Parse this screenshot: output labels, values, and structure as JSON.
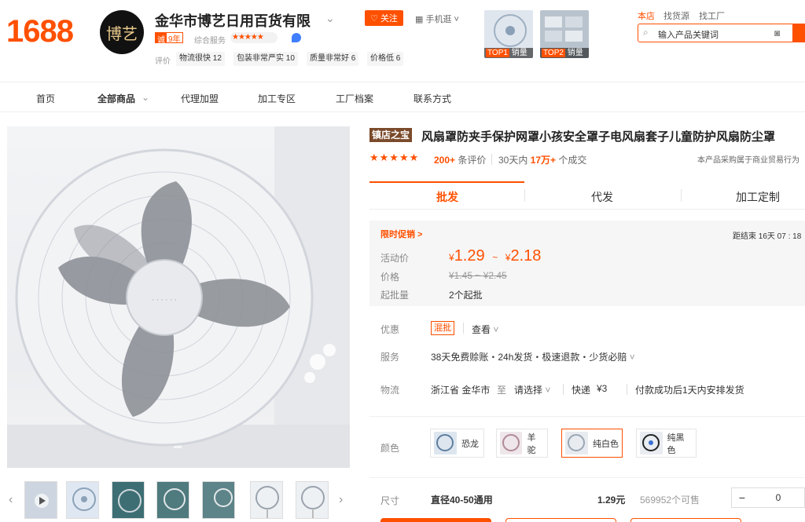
{
  "header": {
    "logo": "1688",
    "shop_avatar_text": "博艺",
    "shop_name": "金华市博艺日用百货有限",
    "follow": "关注",
    "mobile_shop": "手机逛",
    "year_badge_a": "诚",
    "year_badge_b": "9年",
    "service_label": "综合服务",
    "service_stars": "★★★★★",
    "eval_label": "评价",
    "eval_chips": [
      "物流很快 12",
      "包装非常严实 10",
      "质量非常好 6",
      "价格低 6"
    ],
    "top_thumbs": [
      {
        "rank": "TOP1",
        "label": "销量"
      },
      {
        "rank": "TOP2",
        "label": "销量"
      }
    ],
    "top_links": [
      "本店",
      "找货源",
      "找工厂"
    ],
    "search_placeholder": "输入产品关键词"
  },
  "nav": [
    "首页",
    "全部商品",
    "代理加盟",
    "加工专区",
    "工厂档案",
    "联系方式"
  ],
  "product": {
    "badge": "镇店之宝",
    "title": "风扇罩防夹手保护网罩小孩安全罩子电风扇套子儿童防护风扇防尘罩",
    "rating_stars": "★★★★★",
    "review_count": "200+",
    "review_suffix": "条评价",
    "sold_prefix": "30天内",
    "sold_count": "17万+",
    "sold_suffix": "个成交",
    "b2b_note": "本产品采购属于商业贸易行为",
    "tabs": [
      "批发",
      "代发",
      "加工定制"
    ],
    "promo_label": "限时促销 >",
    "countdown": "距结束  16天 07 : 18",
    "price_label": "活动价",
    "price_low": "1.29",
    "price_high": "2.18",
    "currency": "¥",
    "tilde": "~",
    "orig_label": "价格",
    "orig_price": "¥1.45  ~  ¥2.45",
    "moq_label": "起批量",
    "moq": "2个起批",
    "discount_label": "优惠",
    "discount_tag": "混批",
    "discount_view": "查看",
    "service_label": "服务",
    "service_text": "38天免费赊账・24h发货・极速退款・少货必赔",
    "logistics_label": "物流",
    "origin": "浙江省 金华市",
    "to": "至",
    "dest": "请选择",
    "express": "快递",
    "express_fee": "¥3",
    "ship_note": "付款成功后1天内安排发货",
    "color_label": "颜色",
    "colors": [
      "恐龙",
      "羊驼",
      "纯白色",
      "纯黑色"
    ],
    "size_label": "尺寸",
    "size_name": "直径40-50通用",
    "size_price": "1.29元",
    "stock": "569952个可售",
    "qty_minus": "−",
    "qty_value": "0"
  },
  "colors": {
    "accent": "#ff5000",
    "badge_brown": "#7a4a2a"
  }
}
